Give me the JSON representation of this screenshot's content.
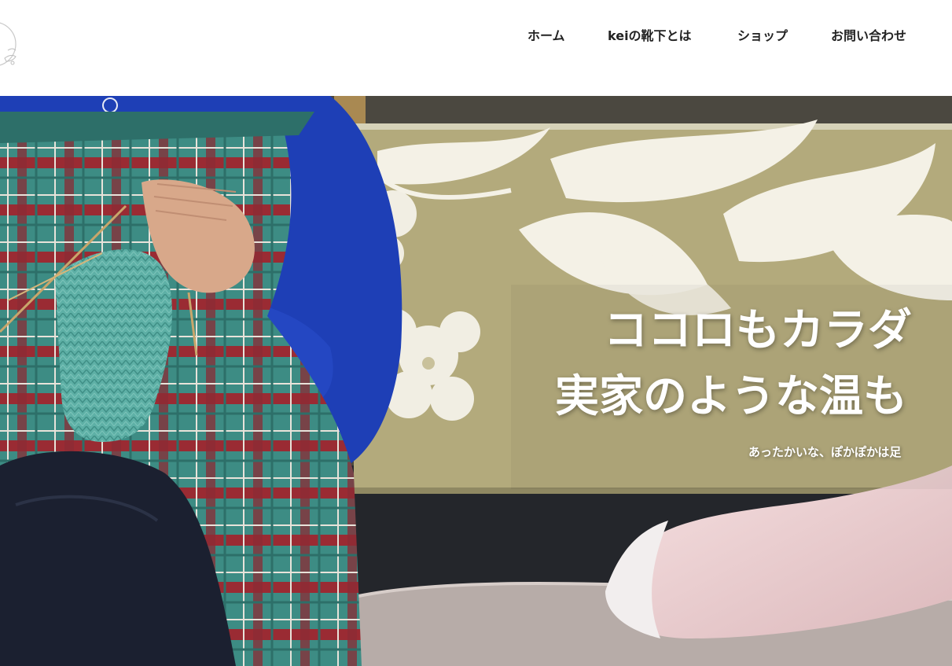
{
  "nav": {
    "items": [
      {
        "label": "ホーム"
      },
      {
        "label": "keiの靴下とは"
      },
      {
        "label": "ショップ"
      },
      {
        "label": "お問い合わせ"
      }
    ]
  },
  "hero": {
    "title_line1": "ココロもカラダ",
    "title_line2": "実家のような温も",
    "subtitle": "あったかいな、ぽかぽかは足"
  },
  "colors": {
    "nav_text": "#222222",
    "hero_text": "#ffffff",
    "sofa_fabric": "#b3aa7c",
    "sweater_blue": "#1e3fb6",
    "apron_teal": "#3d8c84",
    "apron_red": "#9a2b33"
  }
}
